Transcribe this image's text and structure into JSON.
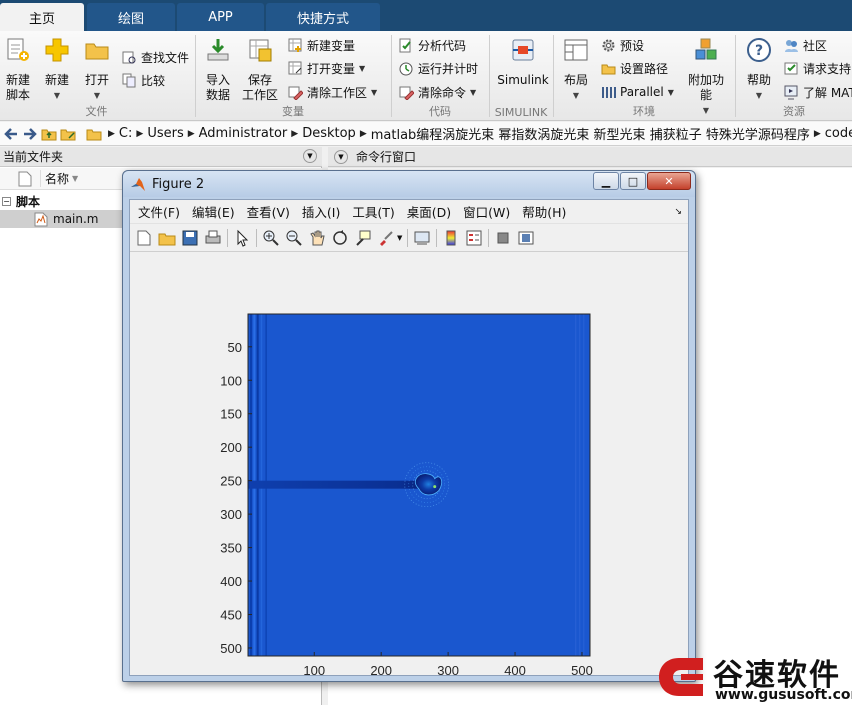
{
  "tabs": [
    {
      "label": "主页",
      "active": true
    },
    {
      "label": "绘图",
      "active": false
    },
    {
      "label": "APP",
      "active": false
    },
    {
      "label": "快捷方式",
      "active": false
    }
  ],
  "ribbon": {
    "file": {
      "group_label": "文件",
      "new_script_line1": "新建",
      "new_script_line2": "脚本",
      "new_label": "新建",
      "open_label": "打开",
      "find_files": "查找文件",
      "compare": "比较"
    },
    "variable": {
      "group_label": "变量",
      "import_line1": "导入",
      "import_line2": "数据",
      "save_line1": "保存",
      "save_line2": "工作区",
      "new_variable": "新建变量",
      "open_variable": "打开变量",
      "clear_workspace": "清除工作区"
    },
    "code": {
      "group_label": "代码",
      "analyze": "分析代码",
      "run_time": "运行并计时",
      "clear_commands": "清除命令"
    },
    "simulink": {
      "group_label": "SIMULINK",
      "label": "Simulink"
    },
    "environment": {
      "group_label": "环境",
      "layout": "布局",
      "preferences": "预设",
      "set_path": "设置路径",
      "parallel": "Parallel",
      "addons": "附加功能"
    },
    "resources": {
      "group_label": "资源",
      "help": "帮助",
      "community": "社区",
      "request_support": "请求支持",
      "learn_matlab": "了解 MATL"
    }
  },
  "address": {
    "crumbs": [
      "C:",
      "Users",
      "Administrator",
      "Desktop",
      "matlab编程涡旋光束 幂指数涡旋光束 新型光束 捕获粒子 特殊光学源码程序",
      "code"
    ]
  },
  "left_panel": {
    "title": "当前文件夹",
    "column_name": "名称",
    "tree": [
      {
        "label": "脚本",
        "type": "group"
      },
      {
        "label": "main.m",
        "type": "file",
        "selected": true
      }
    ]
  },
  "command_window": {
    "title": "命令行窗口"
  },
  "figure": {
    "title": "Figure 2",
    "menu": [
      "文件(F)",
      "编辑(E)",
      "查看(V)",
      "插入(I)",
      "工具(T)",
      "桌面(D)",
      "窗口(W)",
      "帮助(H)"
    ]
  },
  "chart_data": {
    "type": "heatmap",
    "title": "",
    "xlabel": "",
    "ylabel": "",
    "x_ticks": [
      100,
      200,
      300,
      400,
      500
    ],
    "y_ticks": [
      50,
      100,
      150,
      200,
      250,
      300,
      350,
      400,
      450,
      500
    ],
    "xlim": [
      1,
      512
    ],
    "ylim": [
      1,
      512
    ],
    "colormap": "jet",
    "background_color": "#1a57cf",
    "beam_row": 256,
    "beam_end_x": 270,
    "trapped_particle_center": [
      274,
      256
    ]
  },
  "watermark": {
    "brand": "谷速软件",
    "url": "www.gususoft.com",
    "color": "#d11f1f"
  }
}
